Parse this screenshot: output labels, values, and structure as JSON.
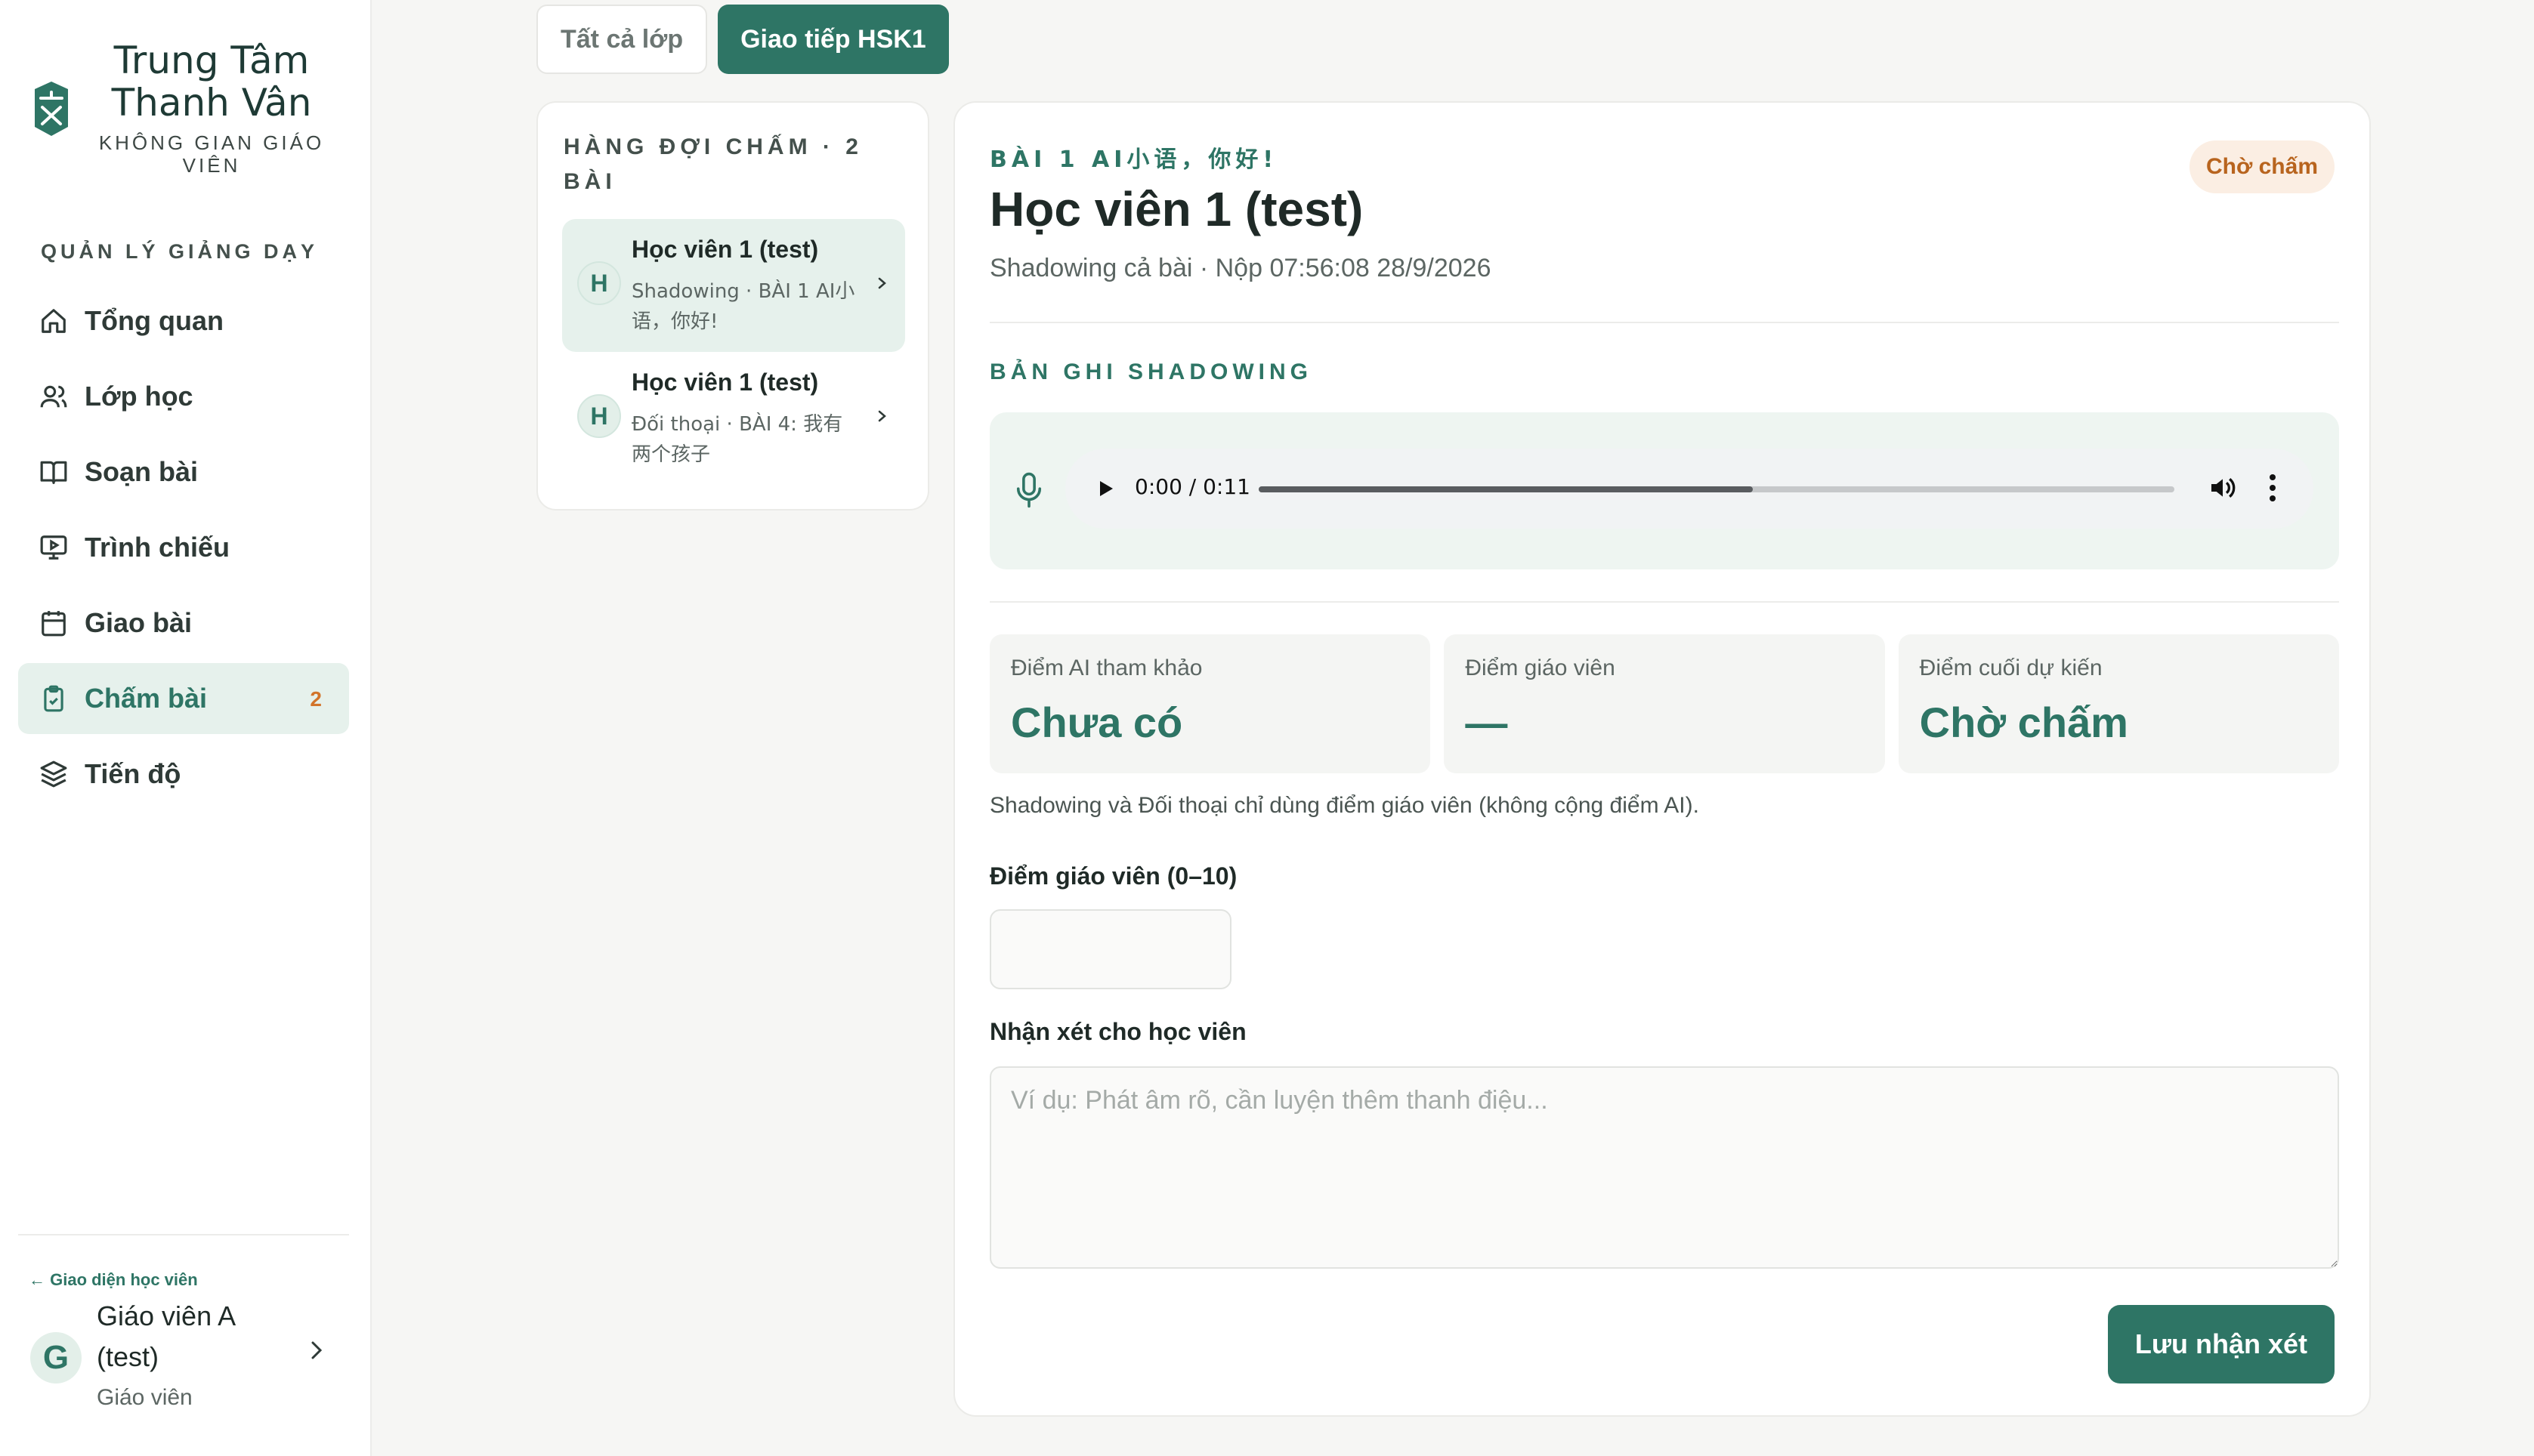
{
  "colors": {
    "accent": "#2e7565",
    "accent_light": "#e6f1ec",
    "pending": "#b8641e",
    "badge": "#d2742a"
  },
  "brand": {
    "title": "Trung Tâm Thanh Vân",
    "subtitle": "KHÔNG GIAN GIÁO VIÊN",
    "logo_icon": "book-logo-icon"
  },
  "sidebar": {
    "heading": "QUẢN LÝ GIẢNG DẠY",
    "items": [
      {
        "label": "Tổng quan",
        "icon": "home-icon"
      },
      {
        "label": "Lớp học",
        "icon": "users-icon"
      },
      {
        "label": "Soạn bài",
        "icon": "book-open-icon"
      },
      {
        "label": "Trình chiếu",
        "icon": "presentation-icon"
      },
      {
        "label": "Giao bài",
        "icon": "calendar-icon"
      },
      {
        "label": "Chấm bài",
        "icon": "clipboard-check-icon",
        "badge": "2",
        "active": true
      },
      {
        "label": "Tiến độ",
        "icon": "layers-icon"
      }
    ],
    "back_link": "← Giao diện học viên",
    "profile": {
      "initial": "G",
      "name": "Giáo viên A (test)",
      "role": "Giáo viên"
    }
  },
  "tabs": [
    {
      "label": "Tất cả lớp",
      "active": false
    },
    {
      "label": "Giao tiếp HSK1",
      "active": true
    }
  ],
  "queue": {
    "title": "HÀNG ĐỢI CHẤM · 2 BÀI",
    "items": [
      {
        "initial": "H",
        "name": "Học viên 1 (test)",
        "meta": "Shadowing · BÀI 1 AI小语，你好!",
        "selected": true
      },
      {
        "initial": "H",
        "name": "Học viên 1 (test)",
        "meta": "Đối thoại · BÀI 4: 我有两个孩子",
        "selected": false
      }
    ]
  },
  "detail": {
    "lesson": "BÀI 1 AI小语，你好!",
    "status": "Chờ chấm",
    "student": "Học viên 1 (test)",
    "sub_info": "Shadowing cả bài · Nộp 07:56:08 28/9/2026",
    "recording_label": "BẢN GHI SHADOWING",
    "audio": {
      "time": "0:00 / 0:11",
      "progress": 0.54
    },
    "scores": [
      {
        "label": "Điểm AI tham khảo",
        "value": "Chưa có"
      },
      {
        "label": "Điểm giáo viên",
        "value": "—"
      },
      {
        "label": "Điểm cuối dự kiến",
        "value": "Chờ chấm"
      }
    ],
    "note": "Shadowing và Đối thoại chỉ dùng điểm giáo viên (không cộng điểm AI).",
    "grade_label": "Điểm giáo viên (0–10)",
    "grade_value": "",
    "comment_label": "Nhận xét cho học viên",
    "comment_placeholder": "Ví dụ: Phát âm rõ, cần luyện thêm thanh điệu...",
    "save_label": "Lưu nhận xét"
  }
}
